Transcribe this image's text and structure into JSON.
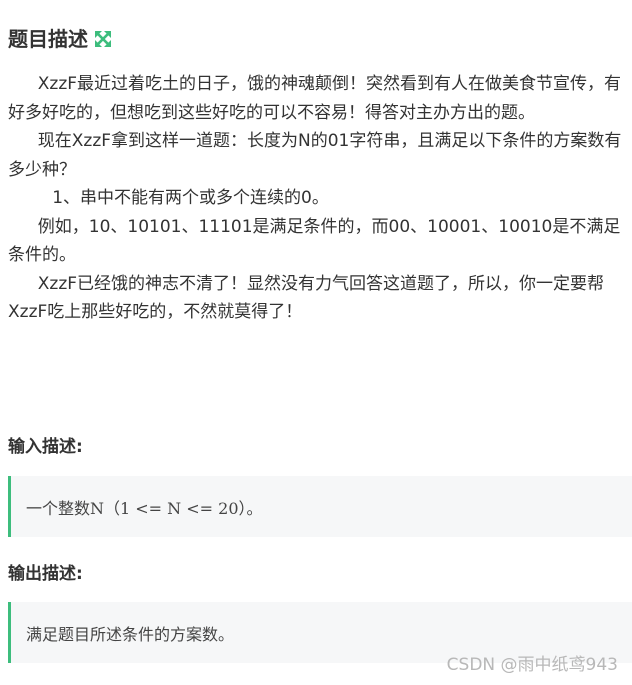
{
  "header": {
    "title": "题目描述",
    "expand_icon": "expand-arrows-icon",
    "accent_color": "#3dbd7d"
  },
  "description": {
    "p1": "XzzF最近过着吃土的日子，饿的神魂颠倒！突然看到有人在做美食节宣传，有好多好吃的，但想吃到这些好吃的可以不容易！得答对主办方出的题。",
    "p2": "现在XzzF拿到这样一道题：长度为N的01字符串，且满足以下条件的方案数有多少种？",
    "p3": "1、串中不能有两个或多个连续的0。",
    "p4": "例如，10、10101、11101是满足条件的，而00、10001、10010是不满足条件的。",
    "p5": "XzzF已经饿的神志不清了！显然没有力气回答这道题了，所以，你一定要帮XzzF吃上那些好吃的，不然就莫得了！"
  },
  "input": {
    "title": "输入描述:",
    "content": "一个整数N（1 <= N <= 20）。"
  },
  "output": {
    "title": "输出描述:",
    "content": "满足题目所述条件的方案数。"
  },
  "watermark": "CSDN @雨中纸鸢943"
}
